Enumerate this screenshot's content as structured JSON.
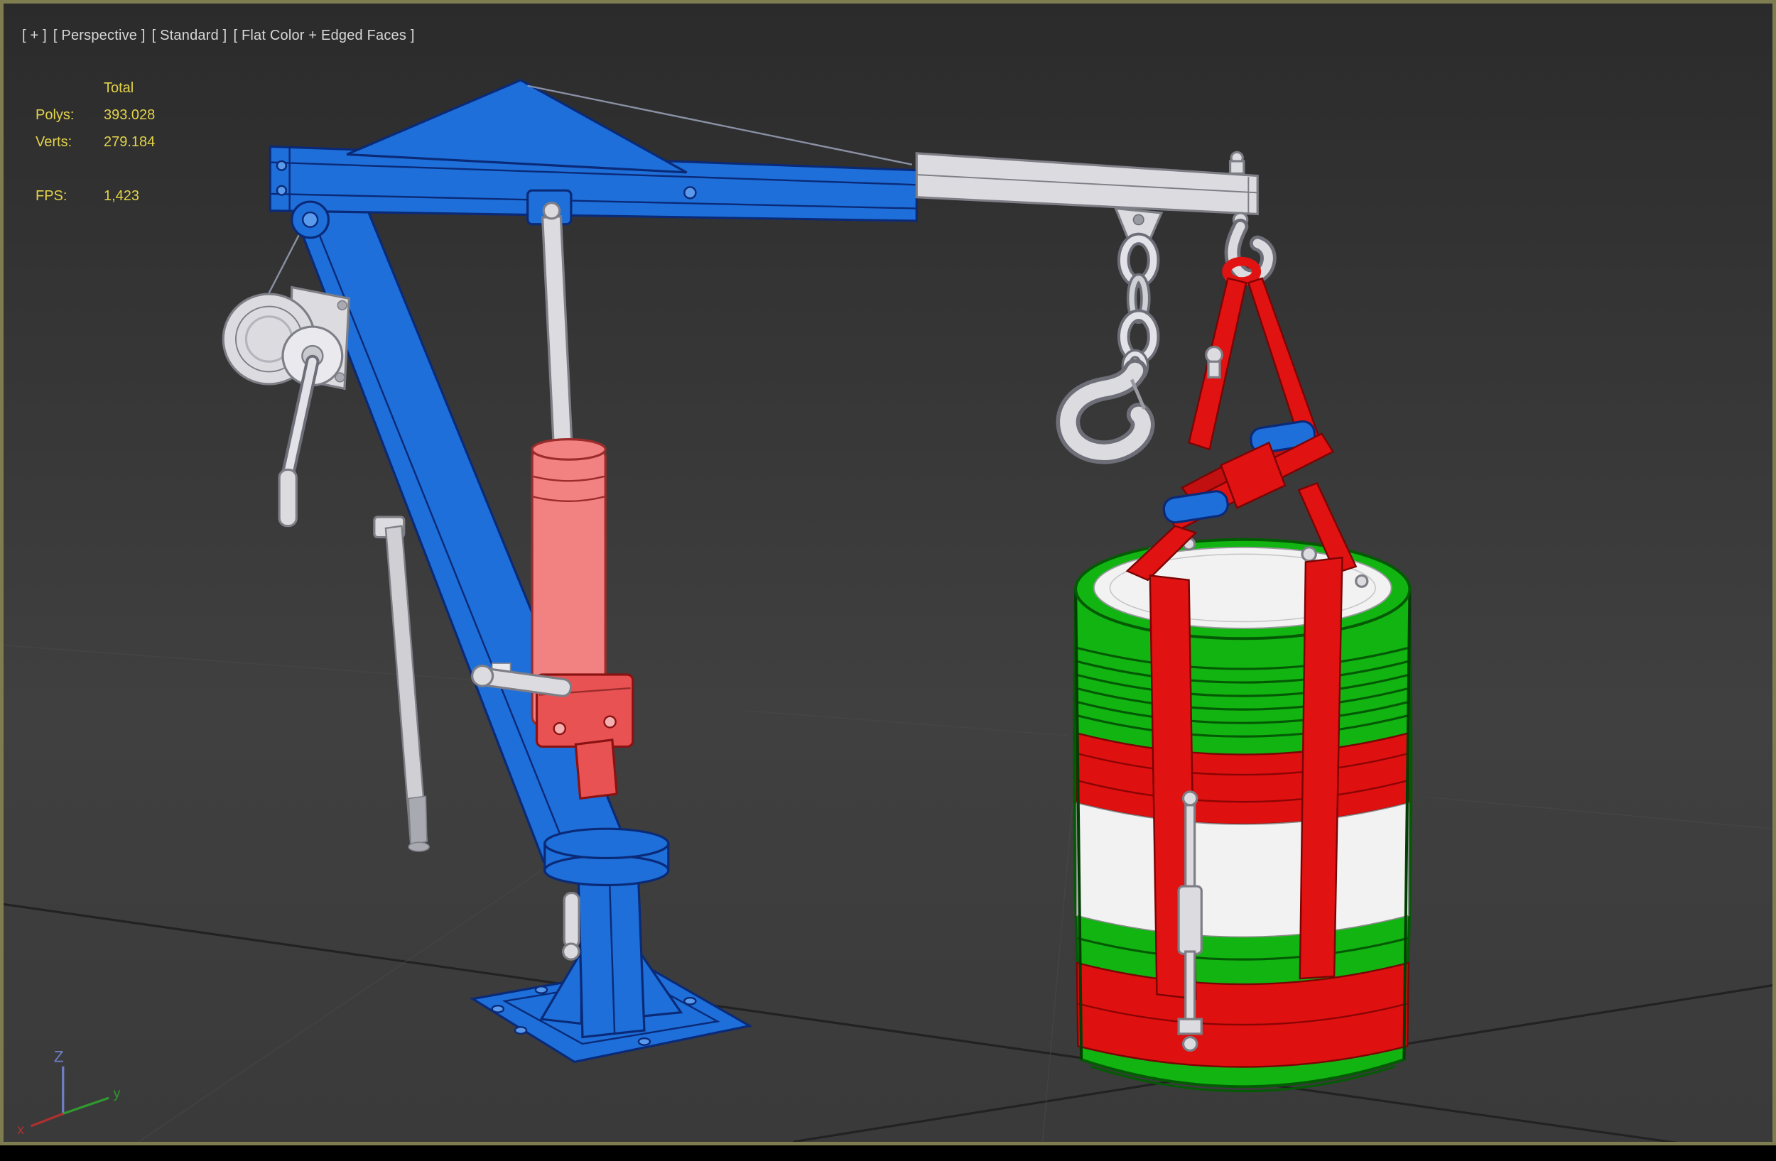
{
  "viewport": {
    "label_segments": [
      {
        "text": "[ + ]"
      },
      {
        "text": "[ Perspective ]"
      },
      {
        "text": "[ Standard ]"
      },
      {
        "text": "[ Flat Color + Edged Faces ]"
      }
    ],
    "stats": {
      "header": "Total",
      "rows": [
        {
          "label": "Polys:",
          "value": "393.028"
        },
        {
          "label": "Verts:",
          "value": "279.184"
        },
        {
          "label": "FPS:",
          "value": "1,423"
        }
      ]
    },
    "axis": {
      "z": "Z",
      "y": "y",
      "x": "x"
    }
  },
  "colors": {
    "viewport_border": "#7d7d50",
    "background": "#3c3c3c",
    "label_text": "#d8d8d8",
    "stats_text": "#e3d34a",
    "crane_blue": "#1e6fd9",
    "cylinder_pink": "#f28282",
    "strap_red": "#e01212",
    "barrel_green": "#12b412",
    "barrel_red": "#de1010",
    "barrel_white": "#f2f2f2",
    "metal_gray": "#dcdce0"
  },
  "scene": {
    "objects": [
      "floor-grid",
      "davit-crane",
      "winch",
      "hydraulic-cylinder",
      "extension-beam",
      "chain",
      "lifting-hook",
      "drum-lifter-straps",
      "barrel"
    ]
  }
}
